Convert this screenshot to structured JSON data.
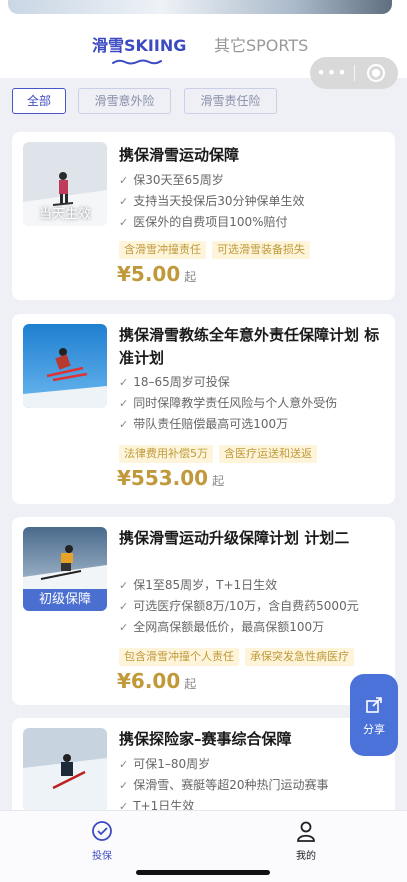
{
  "header": {
    "tabs": [
      {
        "label": "滑雪SKIING",
        "active": true
      },
      {
        "label": "其它SPORTS",
        "active": false
      }
    ]
  },
  "miniprogram_capsule": {
    "more_icon": "more-dots-icon",
    "close_icon": "target-icon",
    "more_label": "•••"
  },
  "filters": [
    {
      "label": "全部",
      "active": true
    },
    {
      "label": "滑雪意外险",
      "active": false
    },
    {
      "label": "滑雪责任险",
      "active": false
    }
  ],
  "products": [
    {
      "title": "携保滑雪运动保障",
      "thumb_caption": "当天生效",
      "features": [
        "保30天至65周岁",
        "支持当天投保后30分钟保单生效",
        "医保外的自费项目100%赔付"
      ],
      "tags": [
        "含滑雪冲撞责任",
        "可选滑雪装备损失"
      ],
      "price": "¥5.00",
      "price_suffix": "起"
    },
    {
      "title": "携保滑雪教练全年意外责任保障计划 标准计划",
      "thumb_caption": "",
      "features": [
        "18–65周岁可投保",
        "同时保障教学责任风险与个人意外受伤",
        "带队责任赔偿最高可选100万"
      ],
      "tags": [
        "法律费用补偿5万",
        "含医疗运送和送返"
      ],
      "price": "¥553.00",
      "price_suffix": "起"
    },
    {
      "title": "携保滑雪运动升级保障计划 计划二",
      "thumb_caption": "初级保障",
      "features": [
        "保1至85周岁，T+1日生效",
        "可选医疗保额8万/10万，含自费药5000元",
        "全网高保额最低价，最高保额100万"
      ],
      "tags": [
        "包含滑雪冲撞个人责任",
        "承保突发急性病医疗"
      ],
      "price": "¥6.00",
      "price_suffix": "起"
    },
    {
      "title": "携保探险家–赛事综合保障",
      "thumb_caption": "",
      "features": [
        "可保1–80周岁",
        "保滑雪、赛艇等超20种热门运动赛事",
        "T+1日生效"
      ],
      "tags": [],
      "price": "",
      "price_suffix": ""
    }
  ],
  "share_button": {
    "label": "分享",
    "icon": "share-icon"
  },
  "bottom_nav": [
    {
      "label": "投保",
      "icon": "insure-icon",
      "active": true
    },
    {
      "label": "我的",
      "icon": "user-icon",
      "active": false
    }
  ],
  "colors": {
    "accent": "#3d4bc0",
    "price": "#c0993a",
    "tag_bg": "#fdf4d9",
    "share_bg": "#4a72d8"
  }
}
